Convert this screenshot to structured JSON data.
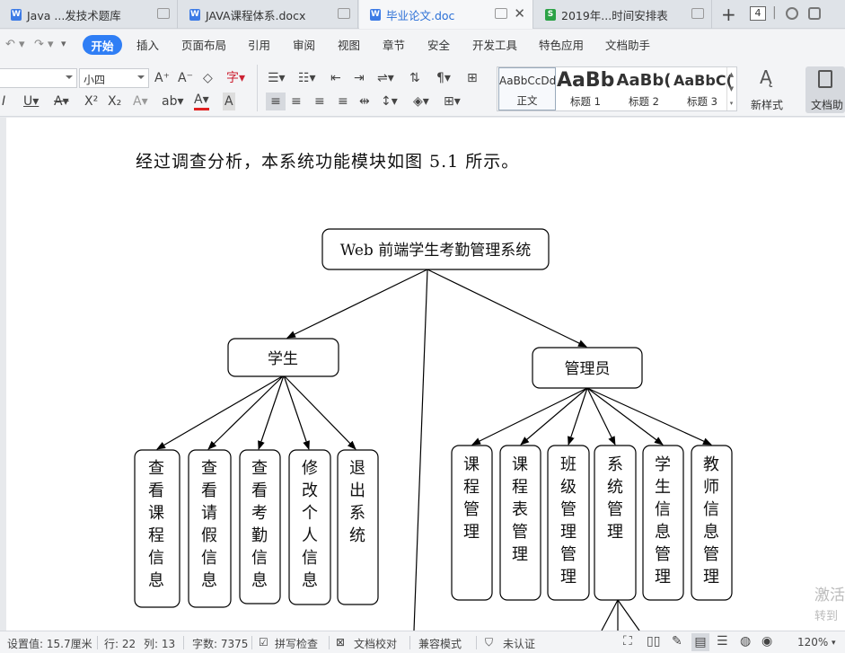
{
  "tabs": [
    {
      "title": "Java ...发技术题库"
    },
    {
      "title": "JAVA课程体系.docx"
    },
    {
      "title": "毕业论文.doc"
    },
    {
      "title": "2019年...时间安排表"
    }
  ],
  "tab_count": "4",
  "menu": [
    "开始",
    "插入",
    "页面布局",
    "引用",
    "审阅",
    "视图",
    "章节",
    "安全",
    "开发工具",
    "特色应用",
    "文档助手"
  ],
  "ribbon": {
    "font_size": "小四",
    "styles": [
      {
        "sample": "AaBbCcDd",
        "name": "正文"
      },
      {
        "sample": "AaBb",
        "name": "标题 1"
      },
      {
        "sample": "AaBb(",
        "name": "标题 2"
      },
      {
        "sample": "AaBbC(",
        "name": "标题 3"
      }
    ],
    "new_style": "新样式",
    "doc_helper": "文档助"
  },
  "document": {
    "intro": "经过调查分析，本系统功能模块如图 5.1 所示。",
    "root": "Web 前端学生考勤管理系统",
    "student": "学生",
    "admin": "管理员",
    "student_items": [
      "查看课程信息",
      "查看请假信息",
      "查看考勤信息",
      "修改个人信息",
      "退出系统"
    ],
    "admin_items": [
      "课程管理",
      "课程表管理",
      "班级管理管理",
      "系统管理",
      "学生信息管理",
      "教师信息管理"
    ]
  },
  "watermark": {
    "line1": "激活",
    "line2": "转到"
  },
  "status": {
    "setting": "设置值: 15.7厘米",
    "row": "行: 22",
    "col": "列: 13",
    "words": "字数: 7375",
    "spell": "拼写检查",
    "proof": "文档校对",
    "compat": "兼容模式",
    "auth": "未认证",
    "zoom": "120%"
  }
}
